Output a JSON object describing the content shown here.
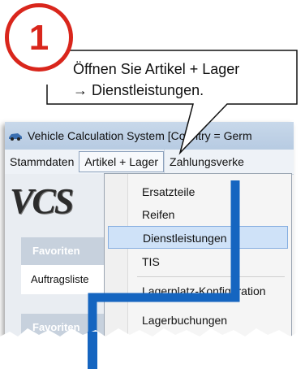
{
  "step": {
    "number": "1"
  },
  "callout": {
    "line1": "Öffnen Sie Artikel + Lager",
    "line2": "→ Dienstleistungen."
  },
  "window": {
    "title": "Vehicle Calculation System [Country = Germ",
    "icon": "car-icon",
    "logo": "VCS"
  },
  "menubar": {
    "items": [
      "Stammdaten",
      "Artikel + Lager",
      "Zahlungsverke"
    ]
  },
  "sidebar": {
    "section1_title": "Favoriten",
    "item1": "Auftragsliste",
    "section2_title": "Favoriten"
  },
  "dropdown": {
    "items": [
      "Ersatzteile",
      "Reifen",
      "Dienstleistungen",
      "TIS",
      "Lagerplatz-Konfiguration",
      "Lagerbuchungen"
    ],
    "selected": "Dienstleistungen"
  },
  "colors": {
    "badge": "#d9261c",
    "guide_line": "#1565c0",
    "highlight": "#cfe2f8"
  }
}
